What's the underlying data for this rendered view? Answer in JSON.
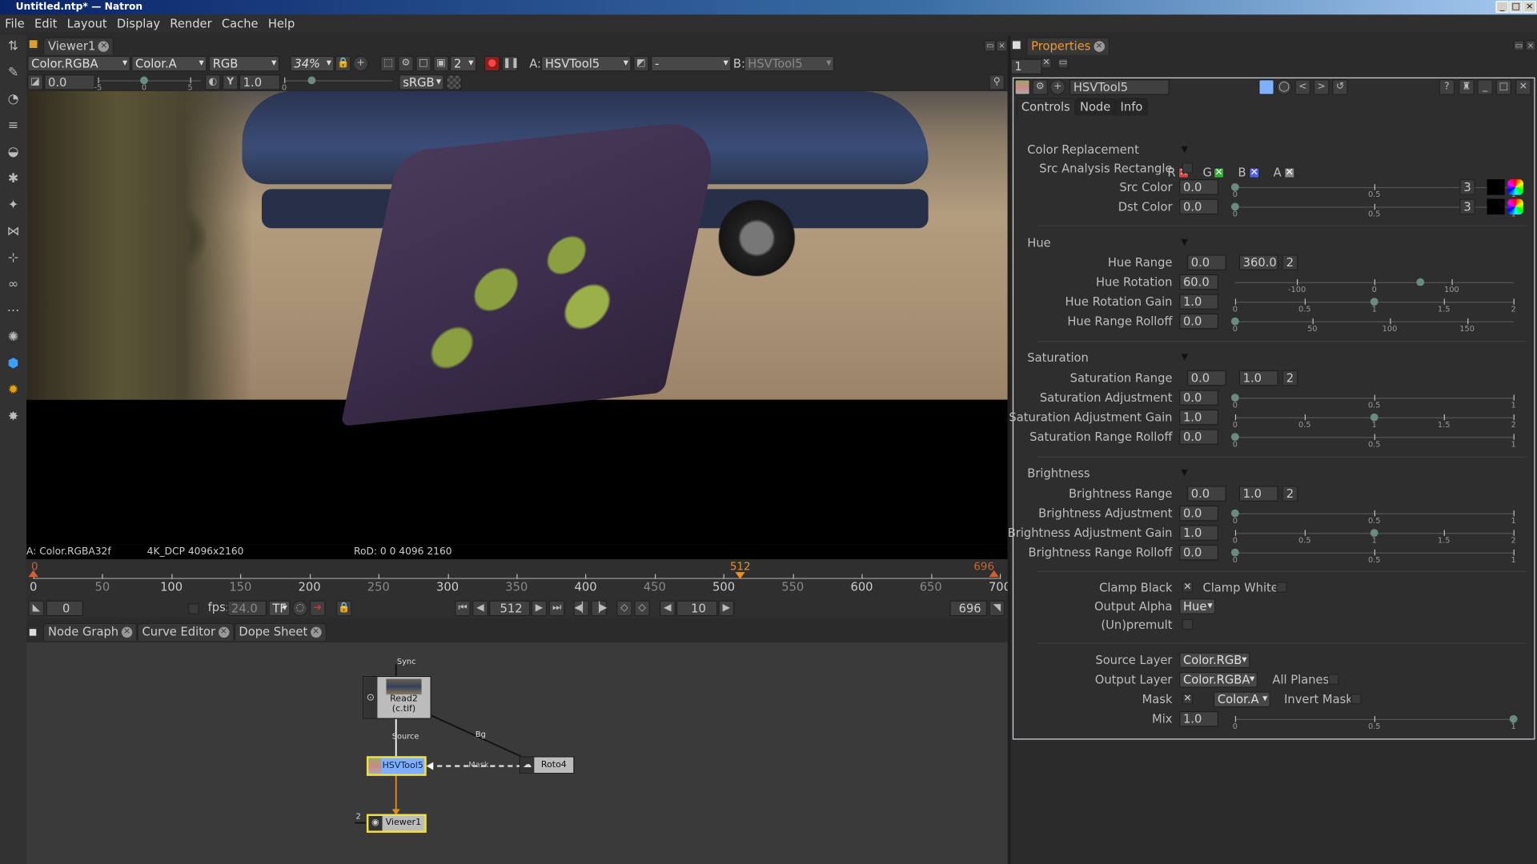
{
  "window": {
    "title": "Untitled.ntp* — Natron"
  },
  "menu": [
    "File",
    "Edit",
    "Layout",
    "Display",
    "Render",
    "Cache",
    "Help"
  ],
  "viewer": {
    "tab": "Viewer1",
    "layer": "Color.RGBA",
    "alpha_channel": "Color.A",
    "display_channels": "RGB",
    "zoom": "34%",
    "input_a": "HSVTool5",
    "operation": "-",
    "input_b": "HSVTool5",
    "gain": "0.0",
    "gamma_label": "Y",
    "gamma": "1.0",
    "colorspace": "sRGB",
    "gain_ticks": [
      "-5",
      "0",
      "5"
    ],
    "gamma_ticks": [
      "0"
    ],
    "proxy_level": "2",
    "info_a": "A: Color.RGBA32f",
    "info_format": "4K_DCP 4096x2160",
    "info_rod": "RoD: 0 0 4096 2160"
  },
  "timeline": {
    "ticks": [
      0,
      50,
      100,
      150,
      200,
      250,
      300,
      350,
      400,
      450,
      500,
      550,
      600,
      650,
      700
    ],
    "range": [
      0,
      700
    ],
    "current_frame": 512,
    "in_point": 0,
    "out_point": 696,
    "current_label": "512",
    "in_label": "0",
    "out_label": "696",
    "start_field": "0",
    "fps_label": "fps:",
    "fps": "24.0",
    "tf": "TF",
    "frame_field": "512",
    "step_field": "10",
    "end_field": "696",
    "marker_color": "#f0901a"
  },
  "bottom_tabs": [
    "Node Graph",
    "Curve Editor",
    "Dope Sheet"
  ],
  "node_graph": {
    "nodes": {
      "read": "Read2",
      "read_file": "(c.tif)",
      "hsv": "HSVTool5",
      "roto": "Roto4",
      "viewer": "Viewer1"
    },
    "edge_labels": {
      "sync": "Sync",
      "source": "Source",
      "bg": "Bg",
      "mask": "Mask",
      "viewer_input": "2"
    },
    "selected_color": "#f0e040",
    "hsv_color": "#7fb0ff"
  },
  "properties": {
    "tab": "Properties",
    "max_panels": "1",
    "node_name": "HSVTool5",
    "subtabs": [
      "Controls",
      "Node",
      "Info"
    ],
    "channels": [
      {
        "label": "R",
        "color": "#e04040"
      },
      {
        "label": "G",
        "color": "#30b030"
      },
      {
        "label": "B",
        "color": "#5060f0"
      },
      {
        "label": "A",
        "color": "#888888"
      }
    ],
    "sections": {
      "color_replacement": "Color Replacement",
      "hue": "Hue",
      "saturation": "Saturation",
      "brightness": "Brightness"
    },
    "src_analysis": "Src Analysis Rectangle",
    "params": [
      {
        "label": "Src Color",
        "value": "0.0",
        "min": 0,
        "max": 1,
        "v": 0,
        "ticks": [
          "0",
          "0.5",
          "1"
        ],
        "dims": "3",
        "color": true
      },
      {
        "label": "Dst Color",
        "value": "0.0",
        "min": 0,
        "max": 1,
        "v": 0,
        "ticks": [
          "0",
          "0.5",
          "1"
        ],
        "dims": "3",
        "color": true
      },
      {
        "label": "Hue Range",
        "value": "0.0",
        "value2": "360.0",
        "dims": "2"
      },
      {
        "label": "Hue Rotation",
        "value": "60.0",
        "min": -180,
        "max": 180,
        "v": 60,
        "ticks": [
          "-100",
          "0",
          "100"
        ]
      },
      {
        "label": "Hue Rotation Gain",
        "value": "1.0",
        "min": 0,
        "max": 2,
        "v": 1,
        "ticks": [
          "0",
          "0.5",
          "1",
          "1.5",
          "2"
        ]
      },
      {
        "label": "Hue Range Rolloff",
        "value": "0.0",
        "min": 0,
        "max": 180,
        "v": 0,
        "ticks": [
          "0",
          "50",
          "100",
          "150"
        ]
      },
      {
        "label": "Saturation Range",
        "value": "0.0",
        "value2": "1.0",
        "dims": "2"
      },
      {
        "label": "Saturation Adjustment",
        "value": "0.0",
        "min": 0,
        "max": 1,
        "v": 0,
        "ticks": [
          "0",
          "0.5",
          "1"
        ]
      },
      {
        "label": "Saturation Adjustment Gain",
        "value": "1.0",
        "min": 0,
        "max": 2,
        "v": 1,
        "ticks": [
          "0",
          "0.5",
          "1",
          "1.5",
          "2"
        ]
      },
      {
        "label": "Saturation Range Rolloff",
        "value": "0.0",
        "min": 0,
        "max": 1,
        "v": 0,
        "ticks": [
          "0",
          "0.5",
          "1"
        ]
      },
      {
        "label": "Brightness Range",
        "value": "0.0",
        "value2": "1.0",
        "dims": "2"
      },
      {
        "label": "Brightness Adjustment",
        "value": "0.0",
        "min": 0,
        "max": 1,
        "v": 0,
        "ticks": [
          "0",
          "0.5",
          "1"
        ]
      },
      {
        "label": "Brightness Adjustment Gain",
        "value": "1.0",
        "min": 0,
        "max": 2,
        "v": 1,
        "ticks": [
          "0",
          "0.5",
          "1",
          "1.5",
          "2"
        ]
      },
      {
        "label": "Brightness Range Rolloff",
        "value": "0.0",
        "min": 0,
        "max": 1,
        "v": 0,
        "ticks": [
          "0",
          "0.5",
          "1"
        ]
      }
    ],
    "clamp_black": "Clamp Black",
    "clamp_black_checked": true,
    "clamp_white": "Clamp White",
    "clamp_white_checked": false,
    "output_alpha_label": "Output Alpha",
    "output_alpha": "Hue",
    "unpremult": "(Un)premult",
    "source_layer_label": "Source Layer",
    "source_layer": "Color.RGB",
    "output_layer_label": "Output Layer",
    "output_layer": "Color.RGBA",
    "all_planes": "All Planes",
    "mask_label": "Mask",
    "mask_checked": true,
    "mask_channel": "Color.A",
    "invert_mask": "Invert Mask",
    "mix": {
      "label": "Mix",
      "value": "1.0",
      "min": 0,
      "max": 1,
      "v": 1,
      "ticks": [
        "0",
        "0.5",
        "1"
      ]
    }
  }
}
